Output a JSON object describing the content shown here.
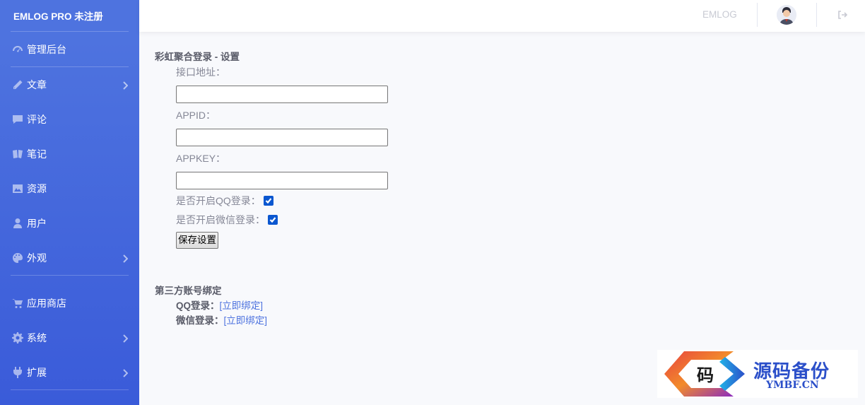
{
  "brand": "EMLOG PRO 未注册",
  "sidebar": {
    "items": [
      {
        "label": "管理后台",
        "icon": "dashboard-icon"
      },
      {
        "label": "文章",
        "icon": "pencil-icon",
        "has_children": true
      },
      {
        "label": "评论",
        "icon": "comment-icon"
      },
      {
        "label": "笔记",
        "icon": "sticky-note-icon"
      },
      {
        "label": "资源",
        "icon": "image-icon"
      },
      {
        "label": "用户",
        "icon": "user-icon"
      },
      {
        "label": "外观",
        "icon": "palette-icon",
        "has_children": true
      },
      {
        "label": "应用商店",
        "icon": "cart-icon"
      },
      {
        "label": "系统",
        "icon": "gear-icon",
        "has_children": true
      },
      {
        "label": "扩展",
        "icon": "plug-icon",
        "has_children": true
      }
    ]
  },
  "topbar": {
    "site_link": "EMLOG",
    "avatar": "avatar",
    "logout_icon": "sign-out-icon"
  },
  "settings": {
    "title": "彩虹聚合登录 - 设置",
    "api_url_label": "接口地址：",
    "api_url_value": "",
    "appid_label": "APPID：",
    "appid_value": "",
    "appkey_label": "APPKEY：",
    "appkey_value": "",
    "qq_enable_label": "是否开启QQ登录：",
    "qq_enabled": true,
    "wechat_enable_label": "是否开启微信登录：",
    "wechat_enabled": true,
    "save_label": "保存设置"
  },
  "binding": {
    "title": "第三方账号绑定",
    "qq_label": "QQ登录：",
    "qq_link": "[立即绑定]",
    "wechat_label": "微信登录：",
    "wechat_link": "[立即绑定]"
  },
  "watermark": {
    "logo_char": "码",
    "text": "源码备份",
    "domain": "YMBF.CN"
  },
  "colors": {
    "sidebar": "#4e73df",
    "link": "#4e73df",
    "checkbox": "#0b57d0"
  }
}
